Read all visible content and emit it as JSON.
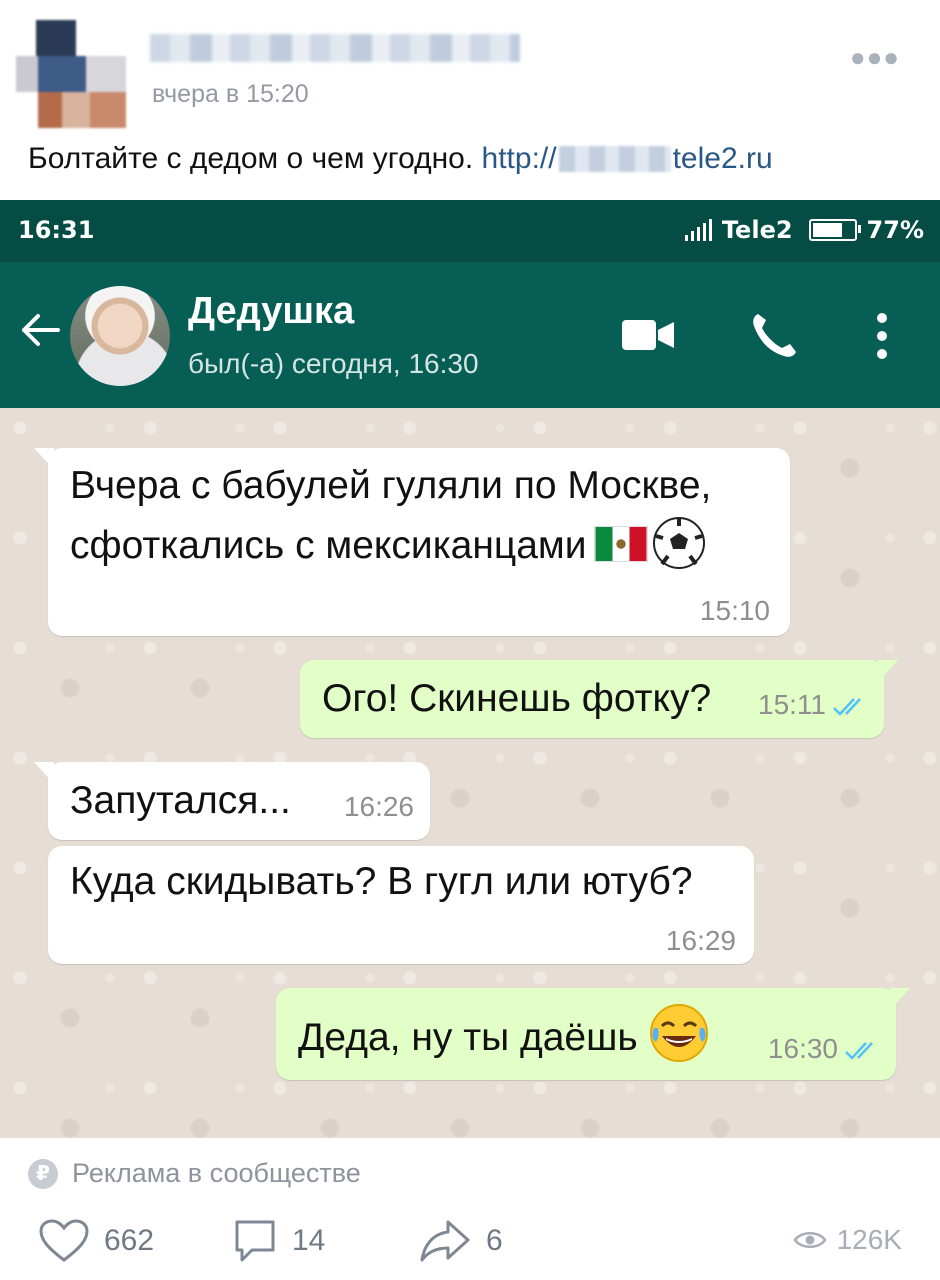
{
  "post": {
    "time": "вчера в 15:20",
    "text": "Болтайте с дедом о чем угодно. ",
    "link_start": "http://",
    "link_end": "tele2.ru"
  },
  "statusbar": {
    "time": "16:31",
    "carrier": "Tele2",
    "battery": "77%",
    "battery_level": 0.77
  },
  "chat": {
    "contact_name": "Дедушка",
    "contact_status": "был(-а) сегодня, 16:30",
    "messages": [
      {
        "dir": "in",
        "lines": [
          "Вчера с бабулей гуляли по Москве,",
          "сфоткались с мексиканцами"
        ],
        "time": "15:10"
      },
      {
        "dir": "out",
        "text": "Ого! Скинешь фотку?",
        "time": "15:11"
      },
      {
        "dir": "in",
        "text": "Запутался...",
        "time": "16:26"
      },
      {
        "dir": "in",
        "text": "Куда скидывать? В гугл или ютуб?",
        "time": "16:29"
      },
      {
        "dir": "out",
        "text": "Деда, ну ты даёшь",
        "time": "16:30"
      }
    ]
  },
  "footer": {
    "ad_label": "Реклама в сообществе",
    "likes": "662",
    "comments": "14",
    "shares": "6",
    "views": "126K"
  },
  "colors": {
    "statusbar_bg": "#054d44",
    "header_bg": "#075e54",
    "bubble_in": "#ffffff",
    "bubble_out": "#e1ffc7",
    "ticks": "#4fc3f7",
    "link": "#2a5885"
  }
}
